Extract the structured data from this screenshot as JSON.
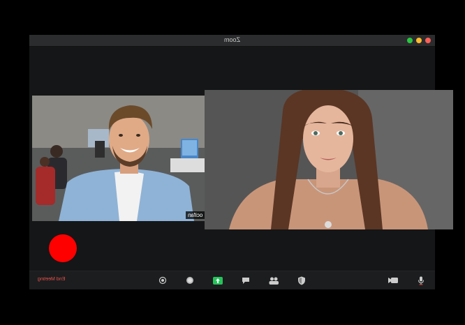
{
  "window": {
    "title": "Zoom"
  },
  "traffic_lights": [
    {
      "name": "minimize",
      "color": "#28c840"
    },
    {
      "name": "zoom",
      "color": "#febc2e"
    },
    {
      "name": "close",
      "color": "#ff5f57"
    }
  ],
  "participants": [
    {
      "name": "ocifan"
    },
    {
      "name": ""
    }
  ],
  "record_indicator": {
    "color": "#ff0000"
  },
  "toolbar": {
    "end_meeting": "End Meeting",
    "icons": [
      "record-icon",
      "reactions-icon",
      "share-screen-icon",
      "chat-icon",
      "participants-icon",
      "security-icon",
      "video-icon",
      "mic-icon"
    ]
  }
}
